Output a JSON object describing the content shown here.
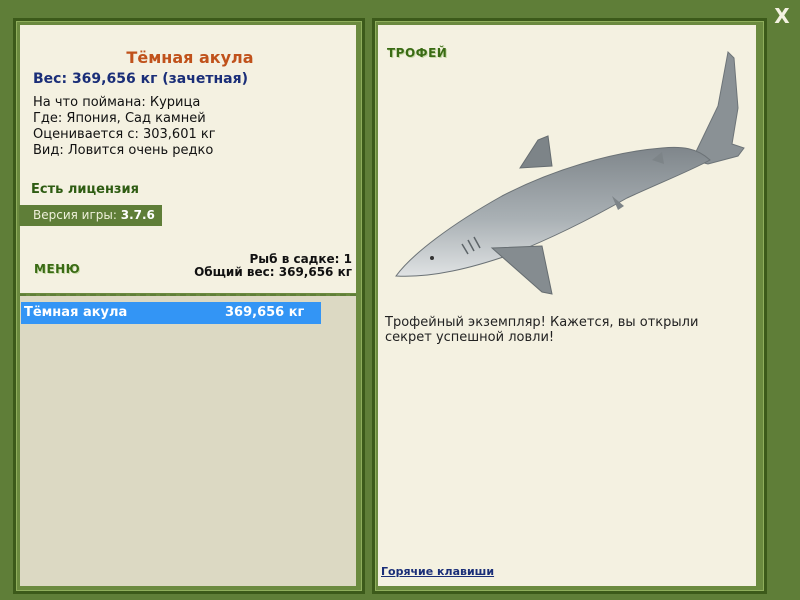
{
  "window": {
    "close_label": "X"
  },
  "fish": {
    "title": "Тёмная акула",
    "weight_line": "Вес: 369,656 кг (зачетная)",
    "caught_on": "На что поймана: Курица",
    "location": "Где: Япония, Сад камней",
    "valued_from": "Оценивается с: 303,601 кг",
    "rarity": "Вид: Ловится очень редко"
  },
  "license": "Есть лицензия",
  "version": {
    "label": "Версия игры:",
    "value": "3.7.6"
  },
  "menu_label": "МЕНЮ",
  "cage": {
    "count_text": "Рыб в садке: 1",
    "total_weight_text": "Общий вес: 369,656 кг"
  },
  "catch_list": [
    {
      "name": "Тёмная акула",
      "weight": "369,656 кг"
    }
  ],
  "trophy": {
    "label": "ТРОФЕЙ",
    "text": "Трофейный экземпляр! Кажется, вы открыли секрет успешной ловли!"
  },
  "hotkeys_label": "Горячие клавиши",
  "colors": {
    "frame_green": "#5f7e38",
    "panel_cream": "#f4f1e1",
    "list_highlight": "#3395f5",
    "title_orange": "#c0521b",
    "weight_blue": "#1a2e78"
  }
}
